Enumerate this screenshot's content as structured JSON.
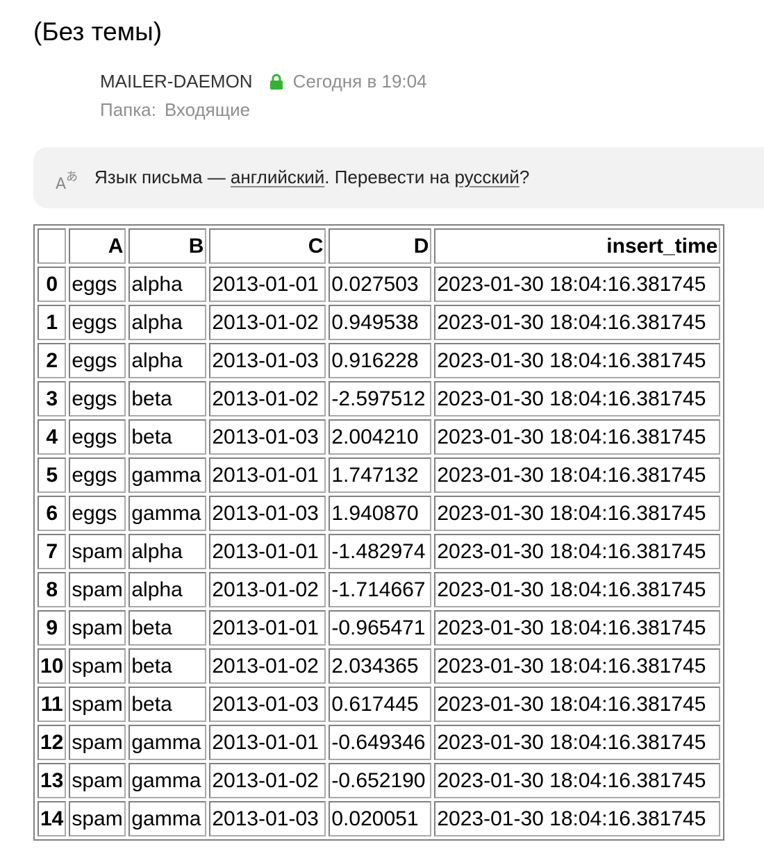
{
  "message": {
    "subject": "(Без темы)",
    "sender": "MAILER-DAEMON",
    "date": "Сегодня в 19:04",
    "folder_label": "Папка:",
    "folder_value": "Входящие"
  },
  "translate": {
    "text_before": "Язык письма — ",
    "language_link": "английский",
    "text_middle": ". Перевести на ",
    "target_link": "русский",
    "text_after": "?"
  },
  "colors": {
    "lock": "#34b233",
    "muted": "#8f8f8f",
    "bar_bg": "#f2f2f2"
  },
  "icons": {
    "lock": "lock-icon",
    "translate": "translate-icon"
  },
  "table": {
    "columns": [
      "",
      "A",
      "B",
      "C",
      "D",
      "insert_time"
    ],
    "rows": [
      [
        "0",
        "eggs",
        "alpha",
        "2013-01-01",
        "0.027503",
        "2023-01-30 18:04:16.381745"
      ],
      [
        "1",
        "eggs",
        "alpha",
        "2013-01-02",
        "0.949538",
        "2023-01-30 18:04:16.381745"
      ],
      [
        "2",
        "eggs",
        "alpha",
        "2013-01-03",
        "0.916228",
        "2023-01-30 18:04:16.381745"
      ],
      [
        "3",
        "eggs",
        "beta",
        "2013-01-02",
        "-2.597512",
        "2023-01-30 18:04:16.381745"
      ],
      [
        "4",
        "eggs",
        "beta",
        "2013-01-03",
        "2.004210",
        "2023-01-30 18:04:16.381745"
      ],
      [
        "5",
        "eggs",
        "gamma",
        "2013-01-01",
        "1.747132",
        "2023-01-30 18:04:16.381745"
      ],
      [
        "6",
        "eggs",
        "gamma",
        "2013-01-03",
        "1.940870",
        "2023-01-30 18:04:16.381745"
      ],
      [
        "7",
        "spam",
        "alpha",
        "2013-01-01",
        "-1.482974",
        "2023-01-30 18:04:16.381745"
      ],
      [
        "8",
        "spam",
        "alpha",
        "2013-01-02",
        "-1.714667",
        "2023-01-30 18:04:16.381745"
      ],
      [
        "9",
        "spam",
        "beta",
        "2013-01-01",
        "-0.965471",
        "2023-01-30 18:04:16.381745"
      ],
      [
        "10",
        "spam",
        "beta",
        "2013-01-02",
        "2.034365",
        "2023-01-30 18:04:16.381745"
      ],
      [
        "11",
        "spam",
        "beta",
        "2013-01-03",
        "0.617445",
        "2023-01-30 18:04:16.381745"
      ],
      [
        "12",
        "spam",
        "gamma",
        "2013-01-01",
        "-0.649346",
        "2023-01-30 18:04:16.381745"
      ],
      [
        "13",
        "spam",
        "gamma",
        "2013-01-02",
        "-0.652190",
        "2023-01-30 18:04:16.381745"
      ],
      [
        "14",
        "spam",
        "gamma",
        "2013-01-03",
        "0.020051",
        "2023-01-30 18:04:16.381745"
      ]
    ]
  }
}
